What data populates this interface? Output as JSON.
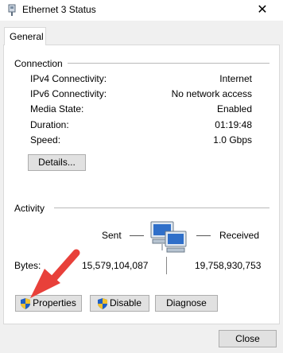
{
  "window": {
    "title": "Ethernet 3 Status",
    "close_glyph": "✕"
  },
  "tabs": [
    {
      "label": "General"
    }
  ],
  "connection": {
    "heading": "Connection",
    "rows": [
      {
        "label": "IPv4 Connectivity:",
        "value": "Internet"
      },
      {
        "label": "IPv6 Connectivity:",
        "value": "No network access"
      },
      {
        "label": "Media State:",
        "value": "Enabled"
      },
      {
        "label": "Duration:",
        "value": "01:19:48"
      },
      {
        "label": "Speed:",
        "value": "1.0 Gbps"
      }
    ],
    "details_button": "Details..."
  },
  "activity": {
    "heading": "Activity",
    "sent_label": "Sent",
    "received_label": "Received",
    "bytes_label": "Bytes:",
    "bytes_sent": "15,579,104,087",
    "bytes_received": "19,758,930,753",
    "icon": "network-computers-icon"
  },
  "buttons": {
    "properties": "Properties",
    "disable": "Disable",
    "diagnose": "Diagnose",
    "close": "Close"
  },
  "colors": {
    "accent_arrow": "#e8403a",
    "panel_border": "#d9d9d9",
    "button_face": "#e1e1e1"
  }
}
